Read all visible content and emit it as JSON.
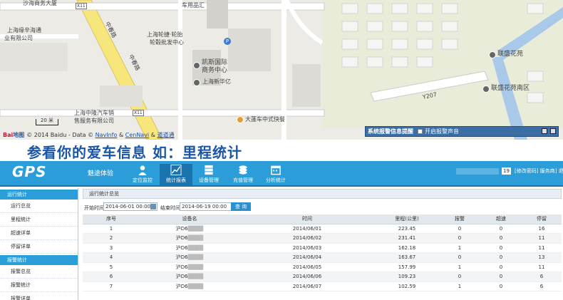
{
  "map": {
    "labels": {
      "top_building": "沙海商务大厦",
      "road_x11_top": "X11",
      "lease_office": "车用品汇",
      "left_company_1": "上海缘辛海通",
      "left_company_2": "业有限公司",
      "tire_1": "上海轮捷·轮胎",
      "tire_2": "轮毂批发中心",
      "road_zhongchun_1": "中春路",
      "road_zhongchun_2": "中春路",
      "kaisi_1": "凯斯国际",
      "kaisi_2": "商务中心",
      "xinhuayi": "上海新华亿",
      "zhonglong_1": "上海中隆汽车销",
      "zhonglong_2": "售服务有限公司",
      "road_x11_bottom": "X11",
      "restaurant": "大蓬车中式快餐",
      "lianshenghuayuan": "联盛花苑",
      "lianshenghuayuan_south": "联盛花苑南区",
      "road_y207": "Y207"
    },
    "scale": "20 米",
    "copyright": "© 2014 Baidu - Data ©",
    "baidu_logo": "Bai",
    "baidu_logo_tail": "地图",
    "navinfo": "NavInfo",
    "amp": "&",
    "cennavi": "CenNavi",
    "amp2": "&",
    "daodaotong": "道道通"
  },
  "alarm_bar": {
    "title": "系统报警信息提醒",
    "sound_label": "开启报警声音"
  },
  "banner": "参看你的爱车信息  如：里程统计",
  "header": {
    "logo": "GPS",
    "subtitle": "魅途体验",
    "nav": [
      "定位监控",
      "统计报表",
      "设备管理",
      "充值管理",
      "分析统计"
    ],
    "user_num": "19",
    "links": "[修改密码] 服务商] 退出"
  },
  "sidebar": {
    "group1": "运行统计",
    "group1_items": [
      "运行总览",
      "里程统计",
      "超速详单",
      "停留详单"
    ],
    "group2": "报警统计",
    "group2_items": [
      "报警总览",
      "报警统计",
      "报警详单"
    ]
  },
  "main": {
    "title": "运行统计总览",
    "start_label": "开始时间:",
    "start_value": "2014-06-01 00:00",
    "end_label": "结束时间:",
    "end_value": "2014-06-19 00:00",
    "query": "查 询",
    "columns": [
      "序号",
      "设备名",
      "时间",
      "里程(公里)",
      "报警",
      "超速",
      "停留"
    ],
    "rows": [
      [
        "1",
        "沪D6",
        "2014/06/01",
        "223.45",
        "0",
        "0",
        "16"
      ],
      [
        "2",
        "沪D6",
        "2014/06/02",
        "231.41",
        "0",
        "0",
        "11"
      ],
      [
        "3",
        "沪D6",
        "2014/06/03",
        "162.18",
        "1",
        "0",
        "11"
      ],
      [
        "4",
        "沪D6",
        "2014/06/04",
        "163.67",
        "0",
        "0",
        "13"
      ],
      [
        "5",
        "沪D6",
        "2014/06/05",
        "157.99",
        "1",
        "0",
        "11"
      ],
      [
        "6",
        "沪D6",
        "2014/06/06",
        "109.23",
        "0",
        "0",
        "6"
      ],
      [
        "7",
        "沪D6",
        "2014/06/07",
        "102.59",
        "1",
        "0",
        "6"
      ]
    ]
  },
  "colors": {
    "primary": "#2b9ed9",
    "header_dark": "#1b74ad",
    "banner_text": "#1a55a8"
  }
}
